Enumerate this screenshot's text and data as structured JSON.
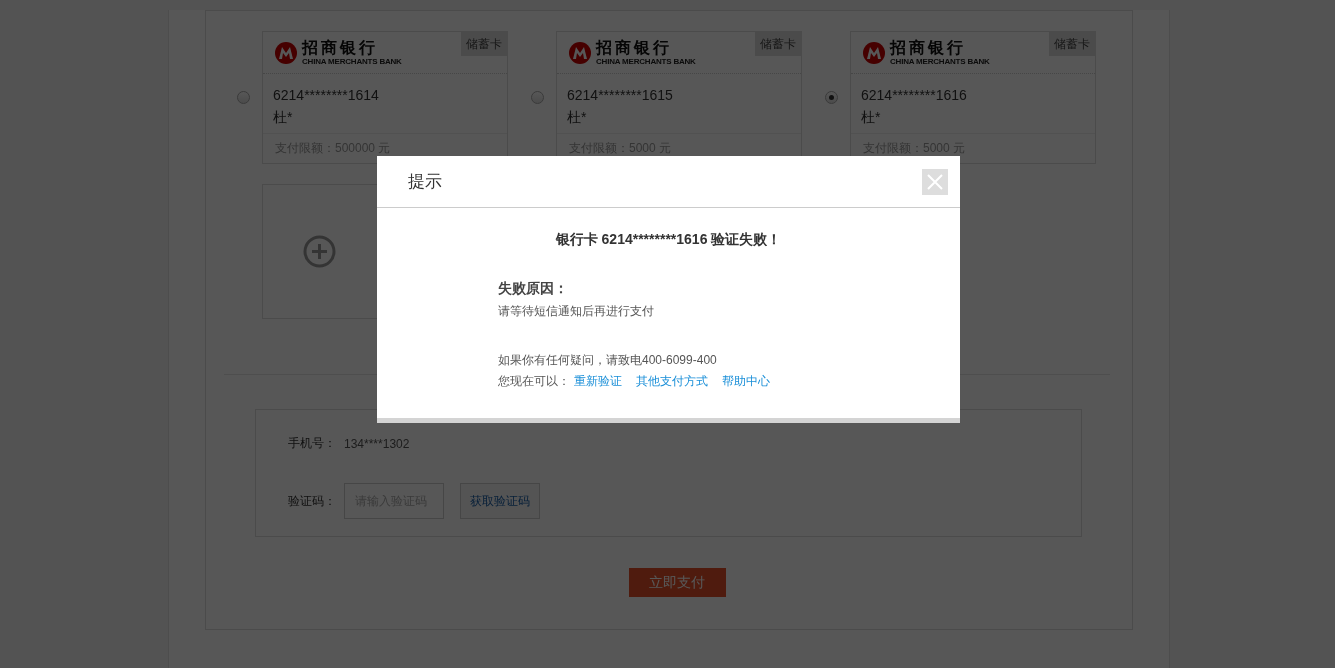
{
  "cards": [
    {
      "bank_name": "招商银行",
      "bank_name_en": "CHINA MERCHANTS BANK",
      "card_type": "储蓄卡",
      "number": "6214********1614",
      "holder": "杜*",
      "limit": "支付限额：500000 元",
      "selected": false
    },
    {
      "bank_name": "招商银行",
      "bank_name_en": "CHINA MERCHANTS BANK",
      "card_type": "储蓄卡",
      "number": "6214********1615",
      "holder": "杜*",
      "limit": "支付限额：5000 元",
      "selected": false
    },
    {
      "bank_name": "招商银行",
      "bank_name_en": "CHINA MERCHANTS BANK",
      "card_type": "储蓄卡",
      "number": "6214********1616",
      "holder": "杜*",
      "limit": "支付限额：5000 元",
      "selected": true
    }
  ],
  "phone": {
    "label": "手机号：",
    "value": "134****1302"
  },
  "code": {
    "label": "验证码：",
    "placeholder": "请输入验证码",
    "button": "获取验证码"
  },
  "pay_button": "立即支付",
  "dialog": {
    "title": "提示",
    "message": "银行卡 6214********1616 验证失败！",
    "reason_label": "失败原因：",
    "reason": "请等待短信通知后再进行支付",
    "contact": "如果你有任何疑问，请致电400-6099-400",
    "actions_label": "您现在可以：",
    "actions": [
      "重新验证",
      "其他支付方式",
      "帮助中心"
    ]
  }
}
